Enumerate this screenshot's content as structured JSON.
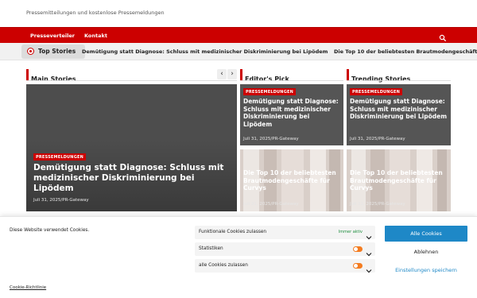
{
  "header": {
    "tagline": "Pressemitteilungen und kostenlose Pressemeldungen"
  },
  "nav": {
    "items": [
      "Presseverteiler",
      "Kontakt"
    ],
    "search_icon": "search-icon"
  },
  "ticker": {
    "label": "Top Stories",
    "items": [
      "Demütigung statt Diagnose: Schluss mit medizinischer Diskriminierung bei Lipödem",
      "Die Top 10 der beliebtesten Brautmodengeschäfte für Curvys"
    ]
  },
  "sections": {
    "main": "Main Stories",
    "editors": "Editor's Pick",
    "trending": "Trending Stories"
  },
  "carousel": {
    "prev_icon": "chevron-left-icon",
    "next_icon": "chevron-right-icon"
  },
  "main_story": {
    "category": "PRESSEMELDUNGEN",
    "title": "Demütigung statt Diagnose: Schluss mit medizinischer Diskriminierung bei Lipödem",
    "meta": "Juli 31, 2025/PR-Gateway"
  },
  "editors_pick": [
    {
      "category": "PRESSEMELDUNGEN",
      "title": "Demütigung statt Diagnose: Schluss mit medizinischer Diskriminierung bei Lipödem",
      "meta": "Juli 31, 2025/PR-Gateway"
    },
    {
      "category": "",
      "title": "Die Top 10 der beliebtesten Brautmodengeschäfte für Curvys",
      "meta": "Juli 31, 2025/PR-Gateway"
    }
  ],
  "trending": [
    {
      "category": "PRESSEMELDUNGEN",
      "title": "Demütigung statt Diagnose: Schluss mit medizinischer Diskriminierung bei Lipödem",
      "meta": "Juli 31, 2025/PR-Gateway"
    },
    {
      "category": "",
      "title": "Die Top 10 der beliebtesten Brautmodengeschäfte für Curvys",
      "meta": "Juli 31, 2025/PR-Gateway"
    }
  ],
  "cookie": {
    "message": "Diese Website verwendet Cookies.",
    "policy_link": "Cookie-Richtlinie",
    "toggles": [
      {
        "label": "Funktionale Cookies zulassen",
        "status": "Immer aktiv"
      },
      {
        "label": "Statistiken",
        "status": ""
      },
      {
        "label": "alle Cookies zulassen",
        "status": ""
      }
    ],
    "accept_all": "Alle Cookies",
    "reject": "Ablehnen",
    "settings": "Einstellungen speichern"
  },
  "colors": {
    "brand_red": "#cc0000",
    "accept_blue": "#1e88c7",
    "toggle_orange": "#f47c20",
    "active_green": "#1e8e3e"
  }
}
